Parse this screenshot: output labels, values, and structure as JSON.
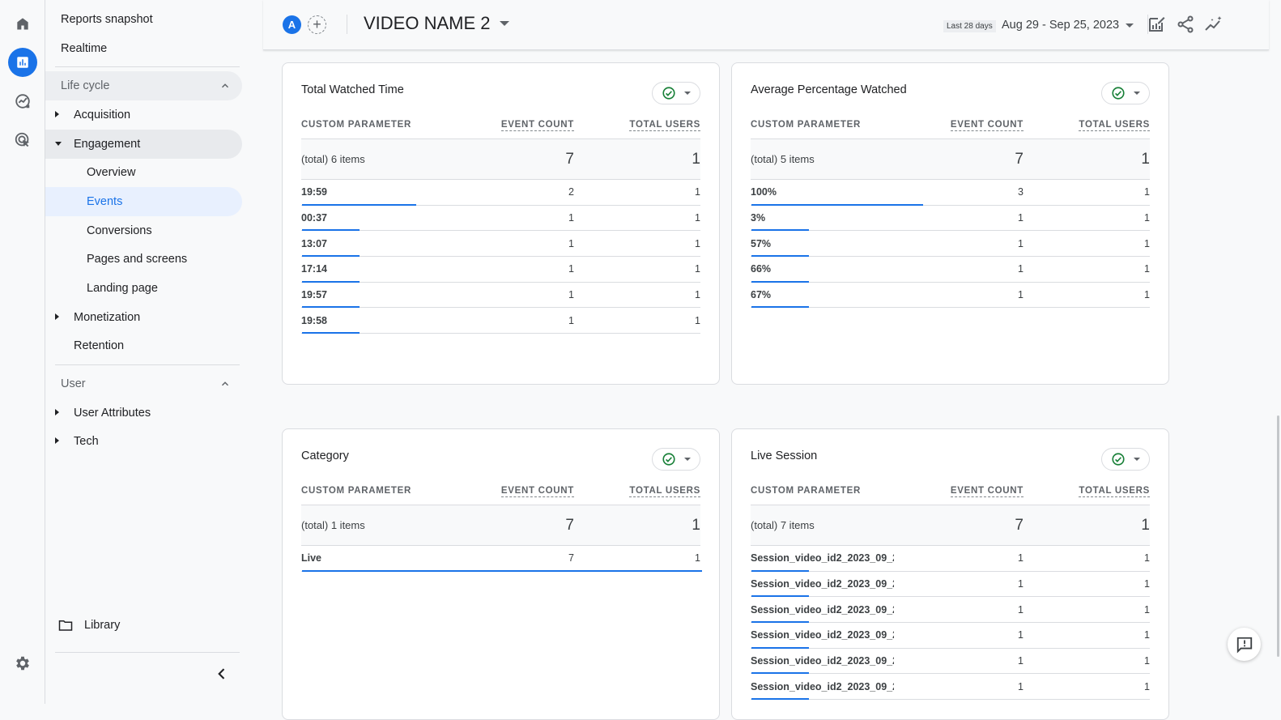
{
  "rail": {
    "icons": [
      {
        "name": "home-icon",
        "active": false
      },
      {
        "name": "reports-icon",
        "active": true
      },
      {
        "name": "explore-icon",
        "active": false
      },
      {
        "name": "advertising-icon",
        "active": false
      }
    ],
    "settings_icon": "gear-icon"
  },
  "nav": {
    "reports_snapshot": "Reports snapshot",
    "realtime": "Realtime",
    "lifecycle_header": "Life cycle",
    "acquisition": "Acquisition",
    "engagement": "Engagement",
    "engagement_children": [
      "Overview",
      "Events",
      "Conversions",
      "Pages and screens",
      "Landing page"
    ],
    "active_child": "Events",
    "monetization": "Monetization",
    "retention": "Retention",
    "user_header": "User",
    "user_attributes": "User Attributes",
    "tech": "Tech",
    "library": "Library"
  },
  "topbar": {
    "avatar_letter": "A",
    "title": "VIDEO NAME 2",
    "date_chip": "Last 28 days",
    "date_range": "Aug 29 - Sep 25, 2023"
  },
  "columns": {
    "param": "CUSTOM PARAMETER",
    "event_count": "EVENT COUNT",
    "total_users": "TOTAL USERS"
  },
  "cards": [
    {
      "title": "Total Watched Time",
      "total_label": "(total) 6 items",
      "total_events": "7",
      "total_users": "1",
      "rows": [
        {
          "param": "19:59",
          "events": "2",
          "users": "1",
          "share": 0.2857
        },
        {
          "param": "00:37",
          "events": "1",
          "users": "1",
          "share": 0.1429
        },
        {
          "param": "13:07",
          "events": "1",
          "users": "1",
          "share": 0.1429
        },
        {
          "param": "17:14",
          "events": "1",
          "users": "1",
          "share": 0.1429
        },
        {
          "param": "19:57",
          "events": "1",
          "users": "1",
          "share": 0.1429
        },
        {
          "param": "19:58",
          "events": "1",
          "users": "1",
          "share": 0.1429
        }
      ]
    },
    {
      "title": "Average Percentage Watched",
      "total_label": "(total) 5 items",
      "total_events": "7",
      "total_users": "1",
      "rows": [
        {
          "param": "100%",
          "events": "3",
          "users": "1",
          "share": 0.4286
        },
        {
          "param": "3%",
          "events": "1",
          "users": "1",
          "share": 0.1429
        },
        {
          "param": "57%",
          "events": "1",
          "users": "1",
          "share": 0.1429
        },
        {
          "param": "66%",
          "events": "1",
          "users": "1",
          "share": 0.1429
        },
        {
          "param": "67%",
          "events": "1",
          "users": "1",
          "share": 0.1429
        }
      ]
    },
    {
      "title": "Category",
      "total_label": "(total) 1 items",
      "total_events": "7",
      "total_users": "1",
      "rows": [
        {
          "param": "Live",
          "events": "7",
          "users": "1",
          "share": 1.0
        }
      ]
    },
    {
      "title": "Live Session",
      "total_label": "(total) 7 items",
      "total_events": "7",
      "total_users": "1",
      "rows": [
        {
          "param": "Session_video_id2_2023_09_2...",
          "events": "1",
          "users": "1",
          "share": 0.1429
        },
        {
          "param": "Session_video_id2_2023_09_2...",
          "events": "1",
          "users": "1",
          "share": 0.1429
        },
        {
          "param": "Session_video_id2_2023_09_2...",
          "events": "1",
          "users": "1",
          "share": 0.1429
        },
        {
          "param": "Session_video_id2_2023_09_2...",
          "events": "1",
          "users": "1",
          "share": 0.1429
        },
        {
          "param": "Session_video_id2_2023_09_2...",
          "events": "1",
          "users": "1",
          "share": 0.1429
        },
        {
          "param": "Session_video_id2_2023_09_2...",
          "events": "1",
          "users": "1",
          "share": 0.1429
        }
      ]
    }
  ],
  "colors": {
    "accent": "#1a73e8",
    "success": "#188038"
  }
}
